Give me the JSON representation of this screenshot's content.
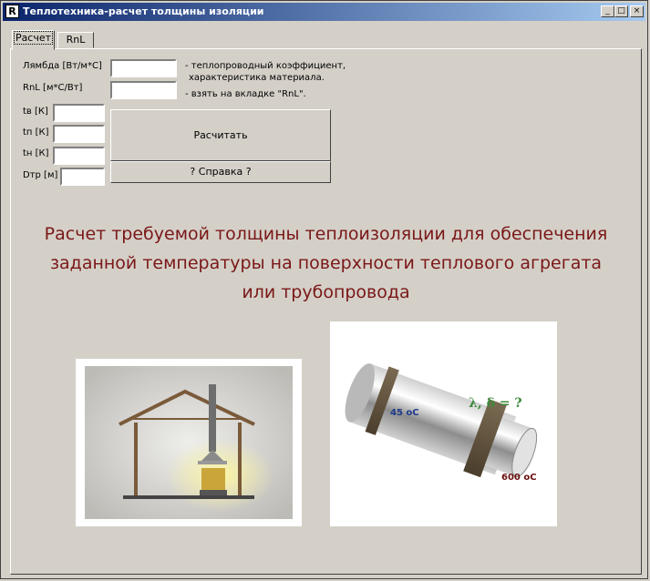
{
  "window": {
    "title": "Теплотехника-расчет толщины изоляции",
    "app_icon_glyph": "R",
    "controls": {
      "minimize": "_",
      "maximize": "□",
      "close": "×"
    }
  },
  "tabs": [
    {
      "label": "Расчет",
      "active": true
    },
    {
      "label": "RnL",
      "active": false
    }
  ],
  "form": {
    "lambda_label": "Лямбда [Вт/м*С]",
    "rnl_label": "RnL [м*С/Вт]",
    "tv_label": "tв [К]",
    "tp_label": "tп [К]",
    "tn_label": "tн [К]",
    "dtr_label": "Dтр [м]",
    "values": {
      "lambda": "",
      "rnl": "",
      "tv": "",
      "tp": "",
      "tn": "",
      "dtr": ""
    }
  },
  "notes": {
    "lambda_line1": "- теплопроводный коэффициент,",
    "lambda_line2": "характеристика материала.",
    "rnl": "- взять на вкладке \"RnL\"."
  },
  "buttons": {
    "calculate": "Расчитать",
    "help": "? Справка ?"
  },
  "heading": {
    "line1": "Расчет требуемой толщины теплоизоляции для обеспечения",
    "line2": "заданной температуры на  поверхности теплового агрегата",
    "line3": "или трубопровода"
  },
  "pipe_image": {
    "inner_temp": "45 оС",
    "outer_temp": "600 оС",
    "question": "λ, δ = ?"
  },
  "colors": {
    "heading": "#7a1717",
    "titlebar_start": "#0a246a",
    "titlebar_end": "#a6caf0"
  }
}
